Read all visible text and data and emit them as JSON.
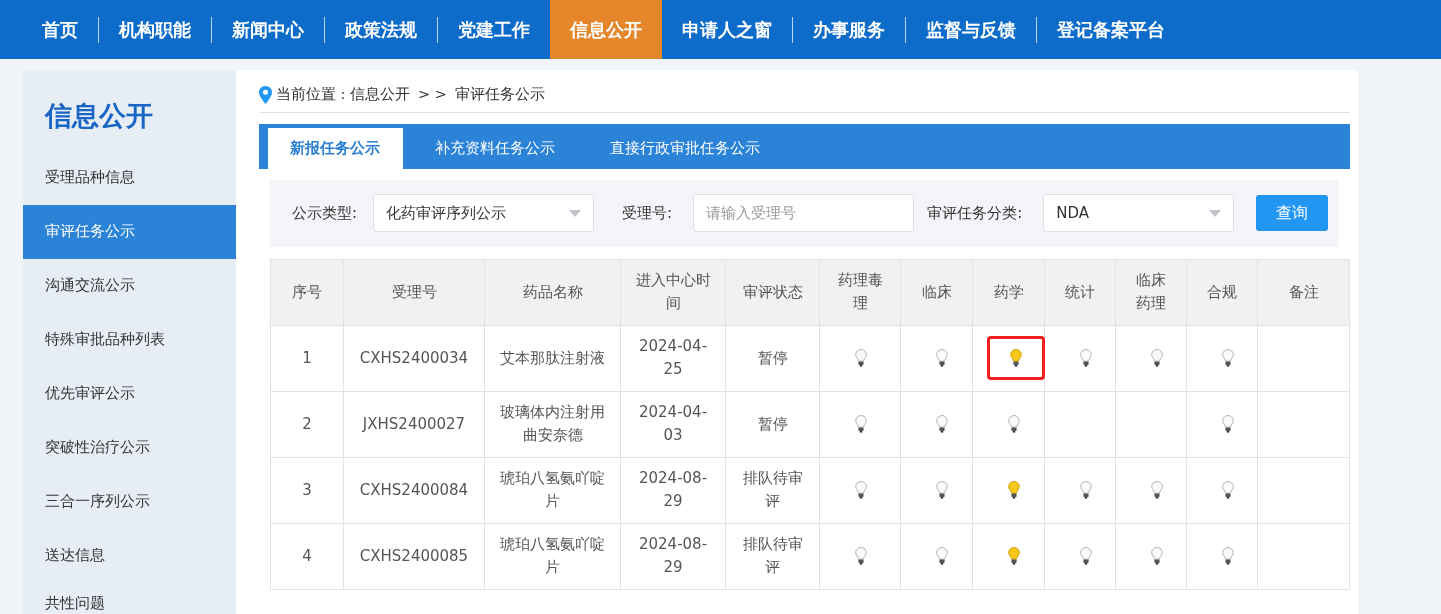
{
  "nav": [
    {
      "label": "首页",
      "selected": false
    },
    {
      "label": "机构职能",
      "selected": false
    },
    {
      "label": "新闻中心",
      "selected": false
    },
    {
      "label": "政策法规",
      "selected": false
    },
    {
      "label": "党建工作",
      "selected": false
    },
    {
      "label": "信息公开",
      "selected": true
    },
    {
      "label": "申请人之窗",
      "selected": false
    },
    {
      "label": "办事服务",
      "selected": false
    },
    {
      "label": "监督与反馈",
      "selected": false
    },
    {
      "label": "登记备案平台",
      "selected": false
    }
  ],
  "sidebar": {
    "title": "信息公开",
    "items": [
      {
        "label": "受理品种信息",
        "selected": false
      },
      {
        "label": "审评任务公示",
        "selected": true
      },
      {
        "label": "沟通交流公示",
        "selected": false
      },
      {
        "label": "特殊审批品种列表",
        "selected": false
      },
      {
        "label": "优先审评公示",
        "selected": false
      },
      {
        "label": "突破性治疗公示",
        "selected": false
      },
      {
        "label": "三合一序列公示",
        "selected": false
      },
      {
        "label": "送达信息",
        "selected": false
      },
      {
        "label": "共性问题",
        "selected": false
      }
    ]
  },
  "breadcrumb": {
    "label": "当前位置 : 信息公开",
    "separator": "> >",
    "current": "审评任务公示"
  },
  "tabs": [
    {
      "label": "新报任务公示",
      "selected": true
    },
    {
      "label": "补充资料任务公示",
      "selected": false
    },
    {
      "label": "直接行政审批任务公示",
      "selected": false
    }
  ],
  "filters": {
    "type_label": "公示类型:",
    "type_value": "化药审评序列公示",
    "number_label": "受理号:",
    "number_placeholder": "请输入受理号",
    "category_label": "审评任务分类:",
    "category_value": "NDA",
    "query_button": "查询"
  },
  "table": {
    "columns": [
      "序号",
      "受理号",
      "药品名称",
      "进入中心时间",
      "审评状态",
      "药理毒理",
      "临床",
      "药学",
      "统计",
      "临床药理",
      "合规",
      "备注"
    ],
    "rows": [
      {
        "cells": [
          "1",
          "CXHS2400034",
          "艾本那肽注射液",
          "2024-04-25",
          "暂停"
        ],
        "bulbs": [
          {
            "kind": "bulb",
            "lit": false,
            "highlighted": false
          },
          {
            "kind": "bulb",
            "lit": false,
            "highlighted": false
          },
          {
            "kind": "bulb",
            "lit": true,
            "highlighted": true
          },
          {
            "kind": "bulb",
            "lit": false,
            "highlighted": false
          },
          {
            "kind": "bulb",
            "lit": false,
            "highlighted": false
          },
          {
            "kind": "bulb",
            "lit": false,
            "highlighted": false
          }
        ]
      },
      {
        "cells": [
          "2",
          "JXHS2400027",
          "玻璃体内注射用曲安奈德",
          "2024-04-03",
          "暂停"
        ],
        "bulbs": [
          {
            "kind": "bulb",
            "lit": false,
            "highlighted": false
          },
          {
            "kind": "bulb",
            "lit": false,
            "highlighted": false
          },
          {
            "kind": "bulb",
            "lit": false,
            "highlighted": false
          },
          {
            "kind": "empty"
          },
          {
            "kind": "empty"
          },
          {
            "kind": "bulb",
            "lit": false,
            "highlighted": false
          }
        ]
      },
      {
        "cells": [
          "3",
          "CXHS2400084",
          "琥珀八氢氨吖啶片",
          "2024-08-29",
          "排队待审评"
        ],
        "bulbs": [
          {
            "kind": "bulb",
            "lit": false,
            "highlighted": false
          },
          {
            "kind": "bulb",
            "lit": false,
            "highlighted": false
          },
          {
            "kind": "bulb",
            "lit": true,
            "highlighted": false
          },
          {
            "kind": "bulb",
            "lit": false,
            "highlighted": false
          },
          {
            "kind": "bulb",
            "lit": false,
            "highlighted": false
          },
          {
            "kind": "bulb",
            "lit": false,
            "highlighted": false
          }
        ]
      },
      {
        "cells": [
          "4",
          "CXHS2400085",
          "琥珀八氢氨吖啶片",
          "2024-08-29",
          "排队待审评"
        ],
        "bulbs": [
          {
            "kind": "bulb",
            "lit": false,
            "highlighted": false
          },
          {
            "kind": "bulb",
            "lit": false,
            "highlighted": false
          },
          {
            "kind": "bulb",
            "lit": true,
            "highlighted": false
          },
          {
            "kind": "bulb",
            "lit": false,
            "highlighted": false
          },
          {
            "kind": "bulb",
            "lit": false,
            "highlighted": false
          },
          {
            "kind": "bulb",
            "lit": false,
            "highlighted": false
          }
        ]
      }
    ]
  }
}
